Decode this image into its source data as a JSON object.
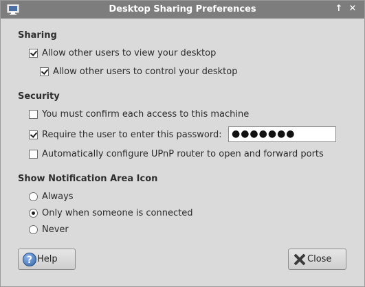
{
  "window": {
    "title": "Desktop Sharing Preferences",
    "maximize_glyph": "↑",
    "close_glyph": "✕"
  },
  "sharing": {
    "heading": "Sharing",
    "allow_view": {
      "label": "Allow other users to view your desktop",
      "checked": true
    },
    "allow_control": {
      "label": "Allow other users to control your desktop",
      "checked": true
    }
  },
  "security": {
    "heading": "Security",
    "confirm_access": {
      "label": "You must confirm each access to this machine",
      "checked": false
    },
    "require_password": {
      "label": "Require the user to enter this password:",
      "checked": true
    },
    "password_value": "●●●●●●●",
    "upnp": {
      "label": "Automatically configure UPnP router to open and forward ports",
      "checked": false
    }
  },
  "notification": {
    "heading": "Show Notification Area Icon",
    "options": [
      {
        "label": "Always",
        "selected": false
      },
      {
        "label": "Only when someone is connected",
        "selected": true
      },
      {
        "label": "Never",
        "selected": false
      }
    ]
  },
  "buttons": {
    "help_label": "Help",
    "close_label": "Close"
  },
  "icons": {
    "app": "monitor-icon",
    "help": "help-icon",
    "close": "close-icon"
  },
  "colors": {
    "titlebar": "#7d7d7d",
    "window_bg": "#dadada",
    "help_icon": "#3465a4"
  }
}
